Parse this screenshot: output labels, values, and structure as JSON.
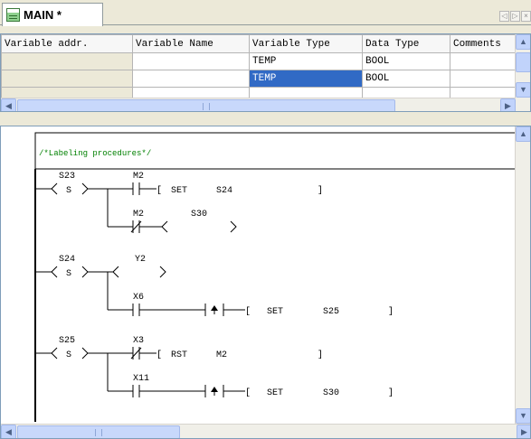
{
  "tab": {
    "label": "MAIN *"
  },
  "tab_nav": {
    "left": "◁",
    "right": "▷",
    "close": "×"
  },
  "table": {
    "headers": [
      "Variable addr.",
      "Variable Name",
      "Variable Type",
      "Data Type",
      "Comments"
    ],
    "rows": [
      [
        "",
        "",
        "TEMP",
        "BOOL",
        ""
      ],
      [
        "",
        "",
        "TEMP",
        "BOOL",
        ""
      ],
      [
        "",
        "",
        "",
        "",
        ""
      ]
    ]
  },
  "scroll": {
    "up": "▲",
    "down": "▼",
    "left": "◀",
    "right": "▶"
  },
  "ladder": {
    "comment": "/*Labeling procedures*/",
    "labels": {
      "s23": "S23",
      "s24": "S24",
      "s25": "S25",
      "m2a": "M2",
      "m2b": "M2",
      "y2": "Y2",
      "x6": "X6",
      "x3": "X3",
      "x11": "X11",
      "s30coil": "S30",
      "coil_s": "S",
      "set": "SET",
      "rst": "RST",
      "arg1": "S24",
      "arg2": "S25",
      "arg3": "M2",
      "arg4": "S30",
      "bracket_open": "[",
      "bracket_close": "]"
    }
  }
}
